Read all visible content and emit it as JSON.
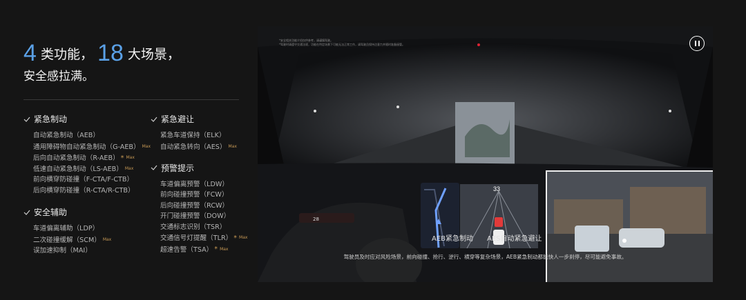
{
  "headline": {
    "num1": "4",
    "text1": "类功能，",
    "num2": "18",
    "text2": "大场景，",
    "line2": "安全感拉满。"
  },
  "columns": [
    {
      "groups": [
        {
          "title": "紧急制动",
          "items": [
            {
              "text": "自动紧急制动（AEB）"
            },
            {
              "text": "通用障碍物自动紧急制动（G-AEB）",
              "badge": "Max"
            },
            {
              "text": "后向自动紧急制动（R-AEB）",
              "star": "*",
              "badge": "Max"
            },
            {
              "text": "低速自动紧急制动（LS-AEB）",
              "badge": "Max"
            },
            {
              "text": "前向横穿防碰撞（F-CTA/F-CTB）"
            },
            {
              "text": "后向横穿防碰撞（R-CTA/R-CTB）"
            }
          ]
        },
        {
          "title": "安全辅助",
          "items": [
            {
              "text": "车道偏离辅助（LDP）"
            },
            {
              "text": "二次碰撞缓解（SCM）",
              "badge": "Max"
            },
            {
              "text": "误加速抑制（MAI）"
            }
          ]
        }
      ]
    },
    {
      "groups": [
        {
          "title": "紧急避让",
          "items": [
            {
              "text": "紧急车道保持（ELK）"
            },
            {
              "text": "自动紧急转向（AES）",
              "badge": "Max"
            }
          ]
        },
        {
          "title": "预警提示",
          "items": [
            {
              "text": "车道偏离预警（LDW）"
            },
            {
              "text": "前向碰撞预警（FCW）"
            },
            {
              "text": "后向碰撞预警（RCW）"
            },
            {
              "text": "开门碰撞预警（DOW）"
            },
            {
              "text": "交通标志识别（TSR）"
            },
            {
              "text": "交通信号灯提醒（TLR）",
              "star": "*",
              "badge": "Max"
            },
            {
              "text": "超速告警（TSA）",
              "star": "*",
              "badge": "Max"
            }
          ]
        }
      ]
    }
  ],
  "video": {
    "fineprint_line1": "*安全相关功能介绍仅供参考，请谨慎驾驶。",
    "fineprint_line2": "*驾驶时请遵守交通法规，功能在特定场景下可能无法正常工作，请驾驶员保持注意力并随时准备接管。",
    "hud_speed": "33",
    "dash_readout": "28",
    "label_aeb": "AEB紧急制动",
    "label_aes": "AES自动紧急避让",
    "subtitle": "驾驶员及时应对风险场景，前向碰撞、抢行、逆行、横穿等复杂场景，AEB紧急制动都能快人一步刹停，尽可能避免事故。",
    "pause_icon": "pause-icon"
  },
  "colors": {
    "accent": "#5aa0e6",
    "badge": "#c89a55",
    "background": "#151515"
  }
}
